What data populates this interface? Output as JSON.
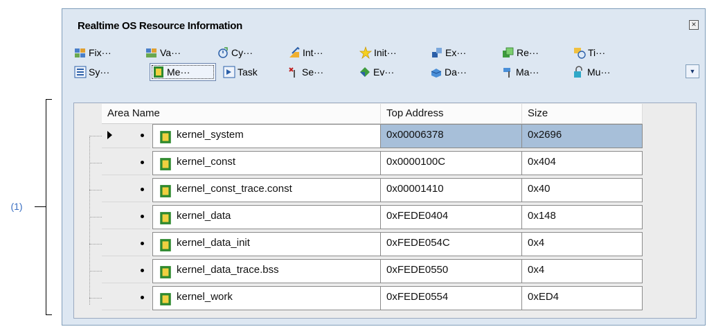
{
  "window": {
    "title": "Realtime OS Resource Information"
  },
  "toolbar_row1": [
    {
      "label": "Fix···",
      "icon": "fixed-memory-pool-icon"
    },
    {
      "label": "Va···",
      "icon": "variable-memory-pool-icon"
    },
    {
      "label": "Cy···",
      "icon": "cyclic-handler-icon"
    },
    {
      "label": "Int···",
      "icon": "interrupt-handler-icon"
    },
    {
      "label": "Init···",
      "icon": "initialize-routine-icon"
    },
    {
      "label": "Ex···",
      "icon": "exception-icon"
    },
    {
      "label": "Re···",
      "icon": "resource-icon"
    },
    {
      "label": "Ti···",
      "icon": "timer-icon"
    }
  ],
  "toolbar_row2": [
    {
      "label": "Sy···",
      "icon": "system-icon"
    },
    {
      "label": "Me···",
      "icon": "memory-area-icon",
      "active": true
    },
    {
      "label": "Task",
      "icon": "task-icon"
    },
    {
      "label": "Se···",
      "icon": "semaphore-icon"
    },
    {
      "label": "Ev···",
      "icon": "eventflag-icon"
    },
    {
      "label": "Da···",
      "icon": "data-queue-icon"
    },
    {
      "label": "Ma···",
      "icon": "mailbox-icon"
    },
    {
      "label": "Mu···",
      "icon": "mutex-icon"
    }
  ],
  "table": {
    "columns": [
      "Area Name",
      "Top Address",
      "Size"
    ],
    "rows": [
      {
        "name": "kernel_system",
        "top_address": "0x00006378",
        "size": "0x2696",
        "selected": true
      },
      {
        "name": "kernel_const",
        "top_address": "0x0000100C",
        "size": "0x404"
      },
      {
        "name": "kernel_const_trace.const",
        "top_address": "0x00001410",
        "size": "0x40"
      },
      {
        "name": "kernel_data",
        "top_address": "0xFEDE0404",
        "size": "0x148"
      },
      {
        "name": "kernel_data_init",
        "top_address": "0xFEDE054C",
        "size": "0x4"
      },
      {
        "name": "kernel_data_trace.bss",
        "top_address": "0xFEDE0550",
        "size": "0x4"
      },
      {
        "name": "kernel_work",
        "top_address": "0xFEDE0554",
        "size": "0xED4"
      }
    ]
  },
  "callout": {
    "label": "(1)"
  },
  "colors": {
    "accent_link": "#3a6fc2",
    "selection": "#a7bfd9"
  }
}
